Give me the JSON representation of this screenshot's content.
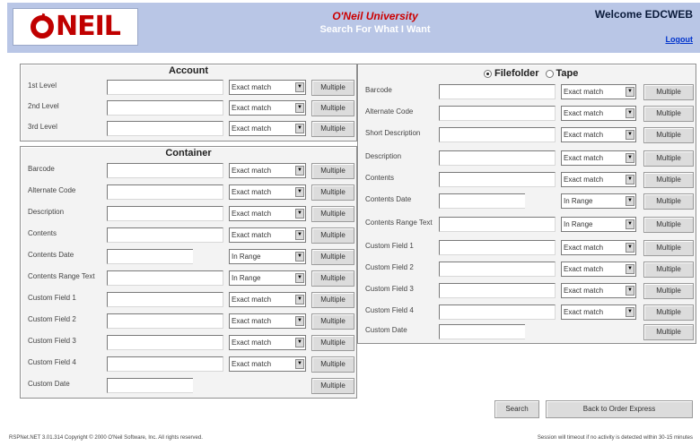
{
  "header": {
    "logo_text": "NEIL",
    "university": "O'Neil University",
    "tagline": "Search For What I Want",
    "welcome": "Welcome EDCWEB",
    "logout": "Logout"
  },
  "account": {
    "title": "Account",
    "rows": [
      {
        "label": "1st Level",
        "match": "Exact match",
        "button": "Multiple"
      },
      {
        "label": "2nd Level",
        "match": "Exact match",
        "button": "Multiple"
      },
      {
        "label": "3rd Level",
        "match": "Exact match",
        "button": "Multiple"
      }
    ]
  },
  "container": {
    "title": "Container",
    "rows": [
      {
        "label": "Barcode",
        "match": "Exact match",
        "button": "Multiple"
      },
      {
        "label": "Alternate Code",
        "match": "Exact match",
        "button": "Multiple"
      },
      {
        "label": "Description",
        "match": "Exact match",
        "button": "Multiple"
      },
      {
        "label": "Contents",
        "match": "Exact match",
        "button": "Multiple"
      },
      {
        "label": "Contents Date",
        "match": "In Range",
        "button": "Multiple"
      },
      {
        "label": "Contents Range Text",
        "match": "In Range",
        "button": "Multiple"
      },
      {
        "label": "Custom Field 1",
        "match": "Exact match",
        "button": "Multiple"
      },
      {
        "label": "Custom Field 2",
        "match": "Exact match",
        "button": "Multiple"
      },
      {
        "label": "Custom Field 3",
        "match": "Exact match",
        "button": "Multiple"
      },
      {
        "label": "Custom Field 4",
        "match": "Exact match",
        "button": "Multiple"
      },
      {
        "label": "Custom Date",
        "match": "",
        "button": "Multiple"
      }
    ]
  },
  "filefolder": {
    "option_filefolder": "Filefolder",
    "option_tape": "Tape",
    "selected": "Filefolder",
    "rows": [
      {
        "label": "Barcode",
        "match": "Exact match",
        "button": "Multiple"
      },
      {
        "label": "Alternate Code",
        "match": "Exact match",
        "button": "Multiple"
      },
      {
        "label": "Short Description",
        "match": "Exact match",
        "button": "Multiple"
      },
      {
        "label": "Description",
        "match": "Exact match",
        "button": "Multiple"
      },
      {
        "label": "Contents",
        "match": "Exact match",
        "button": "Multiple"
      },
      {
        "label": "Contents Date",
        "match": "In Range",
        "button": "Multiple"
      },
      {
        "label": "Contents Range Text",
        "match": "In Range",
        "button": "Multiple"
      },
      {
        "label": "Custom Field 1",
        "match": "Exact match",
        "button": "Multiple"
      },
      {
        "label": "Custom Field 2",
        "match": "Exact match",
        "button": "Multiple"
      },
      {
        "label": "Custom Field 3",
        "match": "Exact match",
        "button": "Multiple"
      },
      {
        "label": "Custom Field 4",
        "match": "Exact match",
        "button": "Multiple"
      },
      {
        "label": "Custom Date",
        "match": "",
        "button": "Multiple"
      }
    ]
  },
  "actions": {
    "search": "Search",
    "back": "Back to Order Express"
  },
  "footer": {
    "left": "RSPNet.NET 3.01.314 Copyright © 2000 O'Neil Software, Inc. All rights reserved.",
    "right": "Session will timeout if no activity is detected within 30-15 minutes"
  }
}
